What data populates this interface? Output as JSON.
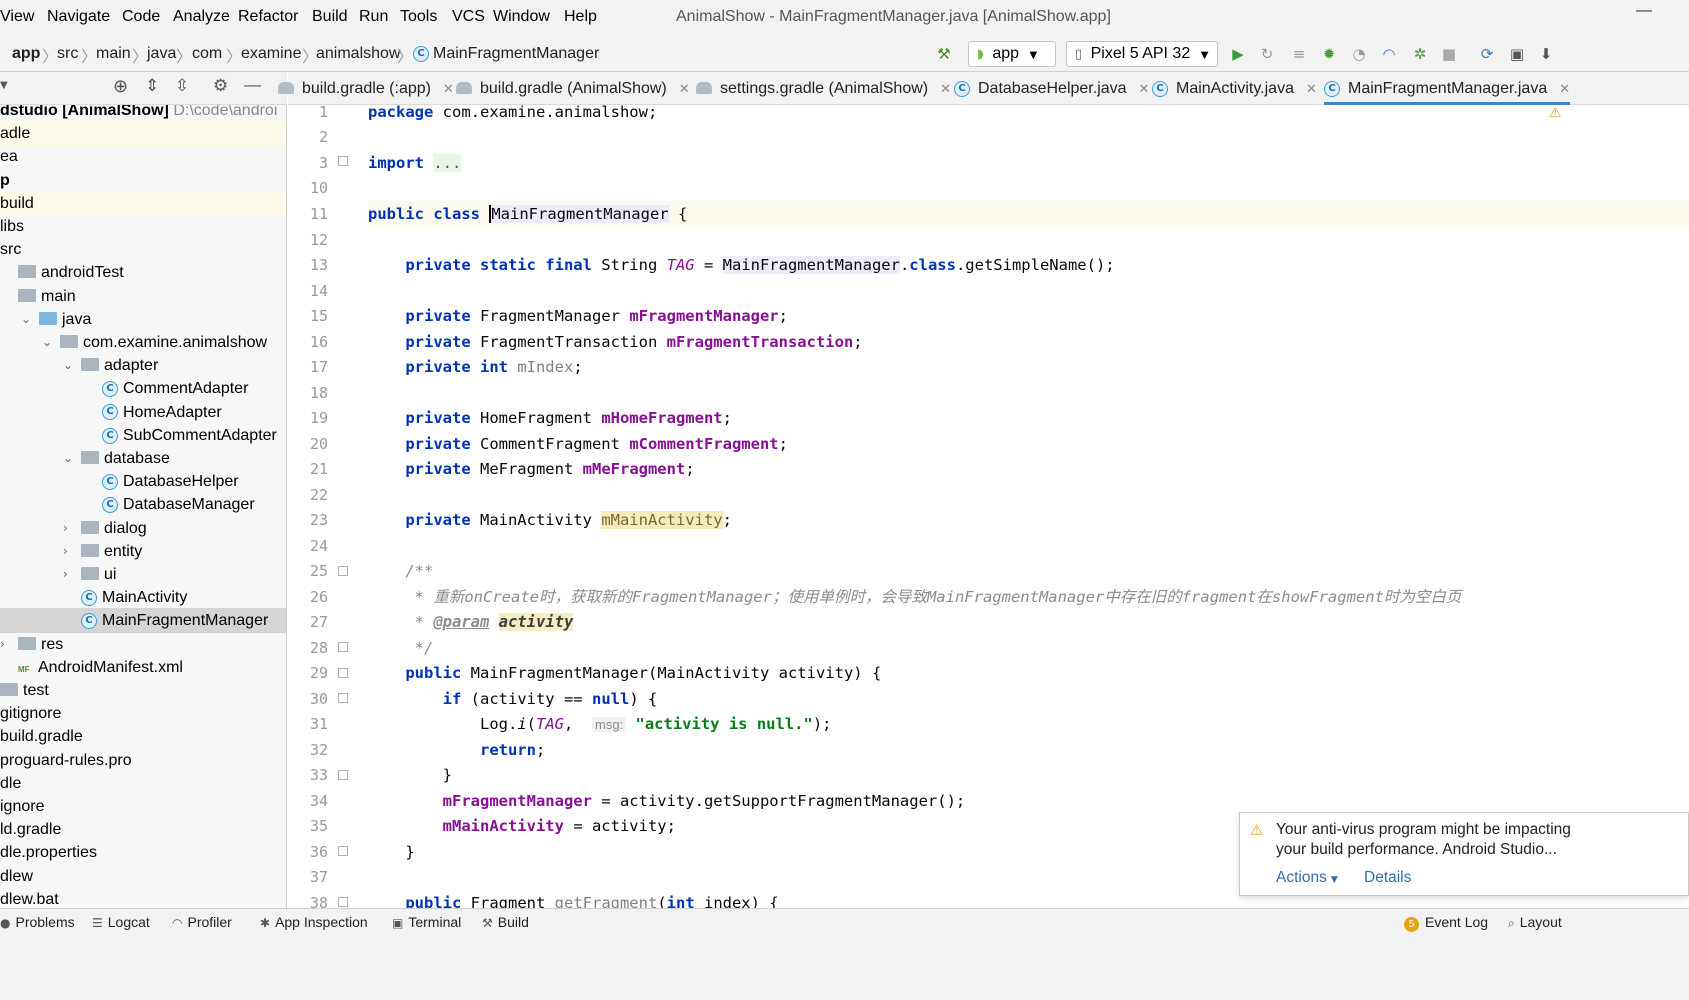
{
  "menu": {
    "items": [
      "View",
      "Navigate",
      "Code",
      "Analyze",
      "Refactor",
      "Build",
      "Run",
      "Tools",
      "VCS",
      "Window",
      "Help"
    ],
    "window_title": "AnimalShow - MainFragmentManager.java [AnimalShow.app]",
    "minimize": "—"
  },
  "breadcrumb": [
    "app",
    "src",
    "main",
    "java",
    "com",
    "examine",
    "animalshow",
    "MainFragmentManager"
  ],
  "toolbar": {
    "run_config": "app",
    "device": "Pixel 5 API 32",
    "icons": [
      "hammer-icon",
      "run-icon",
      "rerun-icon",
      "apply-changes-icon",
      "debug-icon",
      "attach-icon",
      "profile-icon",
      "debug-attach-icon",
      "stop-icon",
      "sync-icon",
      "avd-icon",
      "sdk-icon"
    ]
  },
  "project": {
    "rows": [
      {
        "label": "dstudio [AnimalShow]",
        "suffix": "D:\\code\\androi",
        "indent": 0,
        "bold": true
      },
      {
        "label": "adle",
        "indent": 0,
        "hl": true
      },
      {
        "label": "ea",
        "indent": 0
      },
      {
        "label": "p",
        "indent": 0,
        "bold": true
      },
      {
        "label": "build",
        "indent": 0,
        "hl": true
      },
      {
        "label": "libs",
        "indent": 0
      },
      {
        "label": "src",
        "indent": 0
      },
      {
        "label": "androidTest",
        "indent": 1,
        "folder": "grey"
      },
      {
        "label": "main",
        "indent": 1,
        "folder": "grey"
      },
      {
        "label": "java",
        "indent": 2,
        "folder": "blue",
        "arrow": "down"
      },
      {
        "label": "com.examine.animalshow",
        "indent": 3,
        "folder": "grey",
        "arrow": "down"
      },
      {
        "label": "adapter",
        "indent": 4,
        "folder": "grey",
        "arrow": "down"
      },
      {
        "label": "CommentAdapter",
        "indent": 5,
        "cls": true
      },
      {
        "label": "HomeAdapter",
        "indent": 5,
        "cls": true
      },
      {
        "label": "SubCommentAdapter",
        "indent": 5,
        "cls": true
      },
      {
        "label": "database",
        "indent": 4,
        "folder": "grey",
        "arrow": "down"
      },
      {
        "label": "DatabaseHelper",
        "indent": 5,
        "cls": true
      },
      {
        "label": "DatabaseManager",
        "indent": 5,
        "cls": true
      },
      {
        "label": "dialog",
        "indent": 4,
        "folder": "grey",
        "arrow": "right"
      },
      {
        "label": "entity",
        "indent": 4,
        "folder": "grey",
        "arrow": "right"
      },
      {
        "label": "ui",
        "indent": 4,
        "folder": "grey",
        "arrow": "right"
      },
      {
        "label": "MainActivity",
        "indent": 4,
        "cls": true
      },
      {
        "label": "MainFragmentManager",
        "indent": 4,
        "cls": true,
        "sel": true
      },
      {
        "label": "res",
        "indent": 1,
        "folder": "grey",
        "arrow": "right"
      },
      {
        "label": "AndroidManifest.xml",
        "indent": 1,
        "manifest": true
      },
      {
        "label": "test",
        "indent": 0,
        "folder": "grey"
      },
      {
        "label": "gitignore",
        "indent": 0
      },
      {
        "label": "build.gradle",
        "indent": 0
      },
      {
        "label": "proguard-rules.pro",
        "indent": 0
      },
      {
        "label": "dle",
        "indent": 0
      },
      {
        "label": "ignore",
        "indent": 0
      },
      {
        "label": "ld.gradle",
        "indent": 0
      },
      {
        "label": "dle.properties",
        "indent": 0
      },
      {
        "label": "dlew",
        "indent": 0
      },
      {
        "label": "dlew.bat",
        "indent": 0
      }
    ]
  },
  "tabs": [
    {
      "label": "build.gradle (:app)",
      "kind": "gradle"
    },
    {
      "label": "build.gradle (AnimalShow)",
      "kind": "gradle"
    },
    {
      "label": "settings.gradle (AnimalShow)",
      "kind": "gradle"
    },
    {
      "label": "DatabaseHelper.java",
      "kind": "class"
    },
    {
      "label": "MainActivity.java",
      "kind": "class"
    },
    {
      "label": "MainFragmentManager.java",
      "kind": "class",
      "active": true
    }
  ],
  "editor": {
    "line_numbers": [
      "1",
      "2",
      "3",
      "10",
      "11",
      "12",
      "13",
      "14",
      "15",
      "16",
      "17",
      "18",
      "19",
      "20",
      "21",
      "22",
      "23",
      "24",
      "25",
      "26",
      "27",
      "28",
      "29",
      "30",
      "31",
      "32",
      "33",
      "34",
      "35",
      "36",
      "37",
      "38"
    ],
    "current_line": "11",
    "package_line": "com.examine.animalshow;",
    "import_folded": "...",
    "class_name": "MainFragmentManager",
    "tag_field": "TAG",
    "fields": {
      "mFragmentManager": "mFragmentManager",
      "mFragmentTransaction": "mFragmentTransaction",
      "mIndex": "mIndex",
      "mHomeFragment": "mHomeFragment",
      "mCommentFragment": "mCommentFragment",
      "mMeFragment": "mMeFragment",
      "mMainActivity": "mMainActivity"
    },
    "types": {
      "String": "String",
      "FragmentManager": "FragmentManager",
      "FragmentTransaction": "FragmentTransaction",
      "HomeFragment": "HomeFragment",
      "CommentFragment": "CommentFragment",
      "MeFragment": "MeFragment",
      "MainActivity": "MainActivity"
    },
    "comment_text": "重新onCreate时，获取新的FragmentManager；使用单例时，会导致MainFragmentManager中存在旧的fragment在showFragment时为空白页",
    "param_tag": "@param",
    "param_name": "activity",
    "hint_msg": "msg:",
    "string_literal": "\"activity is null.\"",
    "method_get_fragment": "getFragment"
  },
  "notification": {
    "line1": "Your anti-virus program might be impacting",
    "line2": "your build performance. Android Studio...",
    "actions": "Actions",
    "details": "Details"
  },
  "bottom_tools": [
    {
      "label": "Problems",
      "icon": "problems-icon"
    },
    {
      "label": "Logcat",
      "icon": "logcat-icon"
    },
    {
      "label": "Profiler",
      "icon": "profiler-icon"
    },
    {
      "label": "App Inspection",
      "icon": "inspection-icon"
    },
    {
      "label": "Terminal",
      "icon": "terminal-icon"
    },
    {
      "label": "Build",
      "icon": "build-icon"
    }
  ],
  "bottom_right": {
    "event_log": "Event Log",
    "event_count": "5",
    "layout": "Layout"
  },
  "colors": {
    "keyword": "#0033b3",
    "field": "#871094",
    "string": "#067d17",
    "comment": "#8c8c8c",
    "accent": "#4083c9",
    "warning": "#e8a317"
  }
}
